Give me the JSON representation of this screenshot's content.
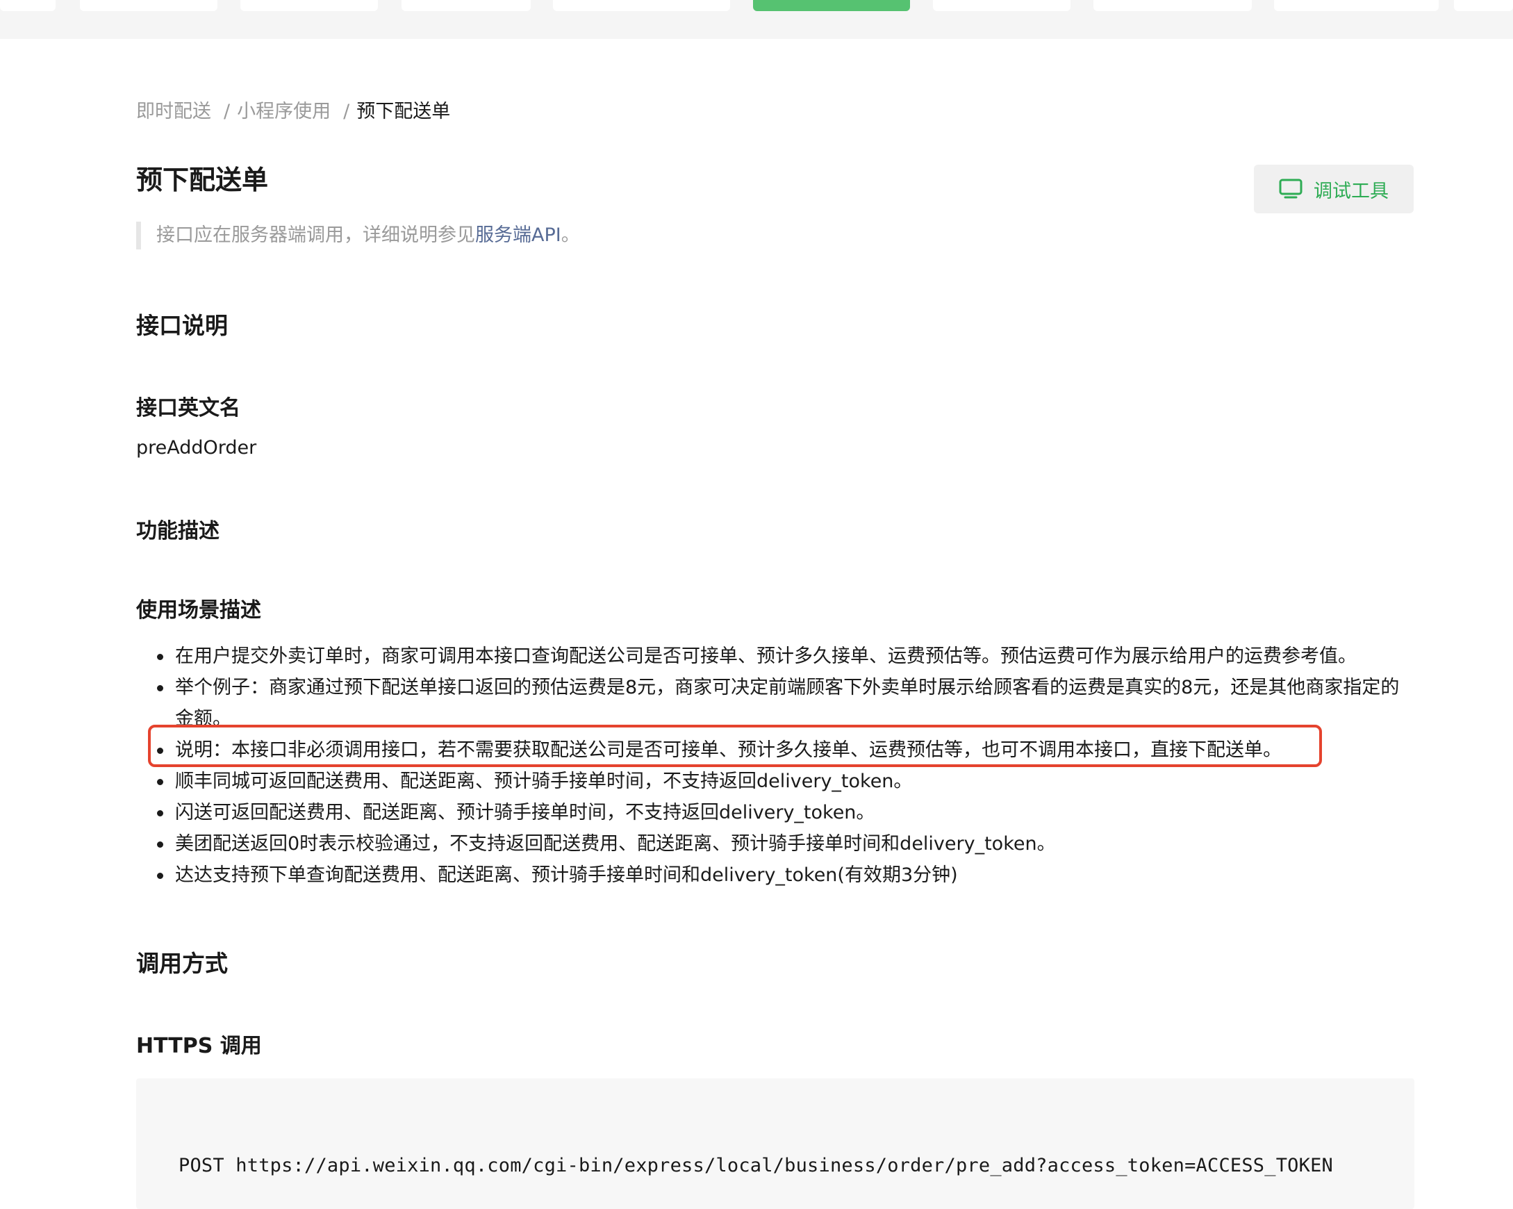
{
  "breadcrumb": {
    "items": [
      "即时配送",
      "小程序使用"
    ],
    "current": "预下配送单",
    "separator": "/"
  },
  "page": {
    "title": "预下配送单",
    "debug_button": "调试工具"
  },
  "notice": {
    "text_before": "接口应在服务器端调用，详细说明参见",
    "link_text": "服务端API",
    "text_after": "。"
  },
  "sections": {
    "interface_desc": "接口说明",
    "english_name_heading": "接口英文名",
    "english_name": "preAddOrder",
    "function_desc": "功能描述",
    "usage_desc": "使用场景描述",
    "call_method": "调用方式",
    "https_call": "HTTPS 调用"
  },
  "usage_items": [
    "在用户提交外卖订单时，商家可调用本接口查询配送公司是否可接单、预计多久接单、运费预估等。预估运费可作为展示给用户的运费参考值。",
    "举个例子：商家通过预下配送单接口返回的预估运费是8元，商家可决定前端顾客下外卖单时展示给顾客看的运费是真实的8元，还是其他商家指定的金额。",
    "说明：本接口非必须调用接口，若不需要获取配送公司是否可接单、预计多久接单、运费预估等，也可不调用本接口，直接下配送单。",
    "顺丰同城可返回配送费用、配送距离、预计骑手接单时间，不支持返回delivery_token。",
    "闪送可返回配送费用、配送距离、预计骑手接单时间，不支持返回delivery_token。",
    "美团配送返回0时表示校验通过，不支持返回配送费用、配送距离、预计骑手接单时间和delivery_token。",
    "达达支持预下单查询配送费用、配送距离、预计骑手接单时间和delivery_token(有效期3分钟)"
  ],
  "code": "POST https://api.weixin.qq.com/cgi-bin/express/local/business/order/pre_add?access_token=ACCESS_TOKEN",
  "colors": {
    "accent_green": "#2eac54",
    "tab_active_green": "#56c271",
    "link_blue": "#576b95",
    "highlight_red": "#e5432e"
  },
  "icons": {
    "debug": "monitor-icon"
  }
}
